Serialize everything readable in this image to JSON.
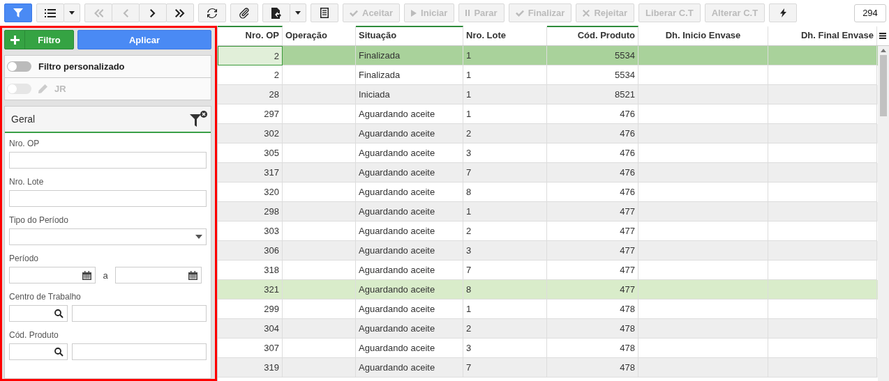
{
  "toolbar_groups": [
    {
      "buttons": [
        {
          "kind": "icon",
          "selected": true,
          "disabled": false
        }
      ]
    },
    {
      "buttons": [
        {
          "kind": "icon",
          "selected": false,
          "disabled": false
        },
        {
          "kind": "caret",
          "selected": false,
          "disabled": false
        }
      ]
    },
    {
      "buttons": [
        {
          "kind": "icon",
          "selected": false,
          "disabled": true
        },
        {
          "kind": "icon",
          "selected": false,
          "disabled": true
        },
        {
          "kind": "icon",
          "selected": false,
          "disabled": false
        },
        {
          "kind": "icon",
          "selected": false,
          "disabled": false
        }
      ]
    },
    {
      "buttons": [
        {
          "kind": "icon",
          "selected": false,
          "disabled": false
        }
      ]
    },
    {
      "buttons": [
        {
          "kind": "icon",
          "selected": false,
          "disabled": false
        }
      ]
    },
    {
      "buttons": [
        {
          "kind": "icon",
          "selected": false,
          "disabled": false
        },
        {
          "kind": "caret",
          "selected": false,
          "disabled": false
        }
      ]
    },
    {
      "buttons": [
        {
          "kind": "icon",
          "selected": false,
          "disabled": false
        }
      ]
    },
    {
      "buttons": [
        {
          "kind": "text",
          "label": "Aceitar",
          "selected": false,
          "disabled": true
        }
      ]
    },
    {
      "buttons": [
        {
          "kind": "text",
          "label": "Iniciar",
          "selected": false,
          "disabled": true
        }
      ]
    },
    {
      "buttons": [
        {
          "kind": "text",
          "label": "Parar",
          "selected": false,
          "disabled": true
        }
      ]
    },
    {
      "buttons": [
        {
          "kind": "text",
          "label": "Finalizar",
          "selected": false,
          "disabled": true
        }
      ]
    },
    {
      "buttons": [
        {
          "kind": "text",
          "label": "Rejeitar",
          "selected": false,
          "disabled": true
        }
      ]
    },
    {
      "buttons": [
        {
          "kind": "text",
          "label": "Liberar C.T",
          "selected": false,
          "disabled": true
        }
      ]
    },
    {
      "buttons": [
        {
          "kind": "text",
          "label": "Alterar C.T",
          "selected": false,
          "disabled": true
        }
      ]
    },
    {
      "buttons": [
        {
          "kind": "icon",
          "selected": false,
          "disabled": false
        }
      ]
    }
  ],
  "record_count": "294",
  "filter_panel": {
    "add_button": "Filtro",
    "apply_button": "Aplicar",
    "custom_filter": {
      "label": "Filtro personalizado",
      "on": false,
      "disabled": false
    },
    "saved_filter": {
      "label": "JR",
      "on": false,
      "disabled": true
    },
    "section": {
      "title": "Geral"
    },
    "fields": [
      {
        "kind": "text",
        "label": "Nro. OP"
      },
      {
        "kind": "text",
        "label": "Nro. Lote"
      },
      {
        "kind": "select",
        "label": "Tipo do Período"
      },
      {
        "kind": "date_range",
        "label": "Período",
        "separator": "a"
      },
      {
        "kind": "lookup",
        "label": "Centro de Trabalho"
      },
      {
        "kind": "lookup",
        "label": "Cód. Produto"
      }
    ]
  },
  "grid": {
    "columns": [
      {
        "label": "Nro. OP",
        "sorted": true
      },
      {
        "label": "Operação",
        "sorted": false
      },
      {
        "label": "Situação",
        "sorted": true
      },
      {
        "label": "Nro. Lote",
        "sorted": false
      },
      {
        "label": "Cód. Produto",
        "sorted": true
      },
      {
        "label": "Dh. Inicio Envase",
        "sorted": false
      },
      {
        "label": "Dh. Final Envase",
        "sorted": false
      }
    ],
    "rows": [
      {
        "nro_op": "2",
        "situacao": "Finalizada",
        "nro_lote": "1",
        "cod_produto": "5534",
        "selected": true,
        "focused": true,
        "hovered": false
      },
      {
        "nro_op": "2",
        "situacao": "Finalizada",
        "nro_lote": "1",
        "cod_produto": "5534",
        "selected": false,
        "focused": false,
        "hovered": false
      },
      {
        "nro_op": "28",
        "situacao": "Iniciada",
        "nro_lote": "1",
        "cod_produto": "8521",
        "selected": false,
        "focused": false,
        "hovered": false
      },
      {
        "nro_op": "297",
        "situacao": "Aguardando aceite",
        "nro_lote": "1",
        "cod_produto": "476",
        "selected": false,
        "focused": false,
        "hovered": false
      },
      {
        "nro_op": "302",
        "situacao": "Aguardando aceite",
        "nro_lote": "2",
        "cod_produto": "476",
        "selected": false,
        "focused": false,
        "hovered": false
      },
      {
        "nro_op": "305",
        "situacao": "Aguardando aceite",
        "nro_lote": "3",
        "cod_produto": "476",
        "selected": false,
        "focused": false,
        "hovered": false
      },
      {
        "nro_op": "317",
        "situacao": "Aguardando aceite",
        "nro_lote": "7",
        "cod_produto": "476",
        "selected": false,
        "focused": false,
        "hovered": false
      },
      {
        "nro_op": "320",
        "situacao": "Aguardando aceite",
        "nro_lote": "8",
        "cod_produto": "476",
        "selected": false,
        "focused": false,
        "hovered": false
      },
      {
        "nro_op": "298",
        "situacao": "Aguardando aceite",
        "nro_lote": "1",
        "cod_produto": "477",
        "selected": false,
        "focused": false,
        "hovered": false
      },
      {
        "nro_op": "303",
        "situacao": "Aguardando aceite",
        "nro_lote": "2",
        "cod_produto": "477",
        "selected": false,
        "focused": false,
        "hovered": false
      },
      {
        "nro_op": "306",
        "situacao": "Aguardando aceite",
        "nro_lote": "3",
        "cod_produto": "477",
        "selected": false,
        "focused": false,
        "hovered": false
      },
      {
        "nro_op": "318",
        "situacao": "Aguardando aceite",
        "nro_lote": "7",
        "cod_produto": "477",
        "selected": false,
        "focused": false,
        "hovered": false
      },
      {
        "nro_op": "321",
        "situacao": "Aguardando aceite",
        "nro_lote": "8",
        "cod_produto": "477",
        "selected": false,
        "focused": false,
        "hovered": true
      },
      {
        "nro_op": "299",
        "situacao": "Aguardando aceite",
        "nro_lote": "1",
        "cod_produto": "478",
        "selected": false,
        "focused": false,
        "hovered": false
      },
      {
        "nro_op": "304",
        "situacao": "Aguardando aceite",
        "nro_lote": "2",
        "cod_produto": "478",
        "selected": false,
        "focused": false,
        "hovered": false
      },
      {
        "nro_op": "307",
        "situacao": "Aguardando aceite",
        "nro_lote": "3",
        "cod_produto": "478",
        "selected": false,
        "focused": false,
        "hovered": false
      },
      {
        "nro_op": "319",
        "situacao": "Aguardando aceite",
        "nro_lote": "7",
        "cod_produto": "478",
        "selected": false,
        "focused": false,
        "hovered": false
      }
    ]
  }
}
